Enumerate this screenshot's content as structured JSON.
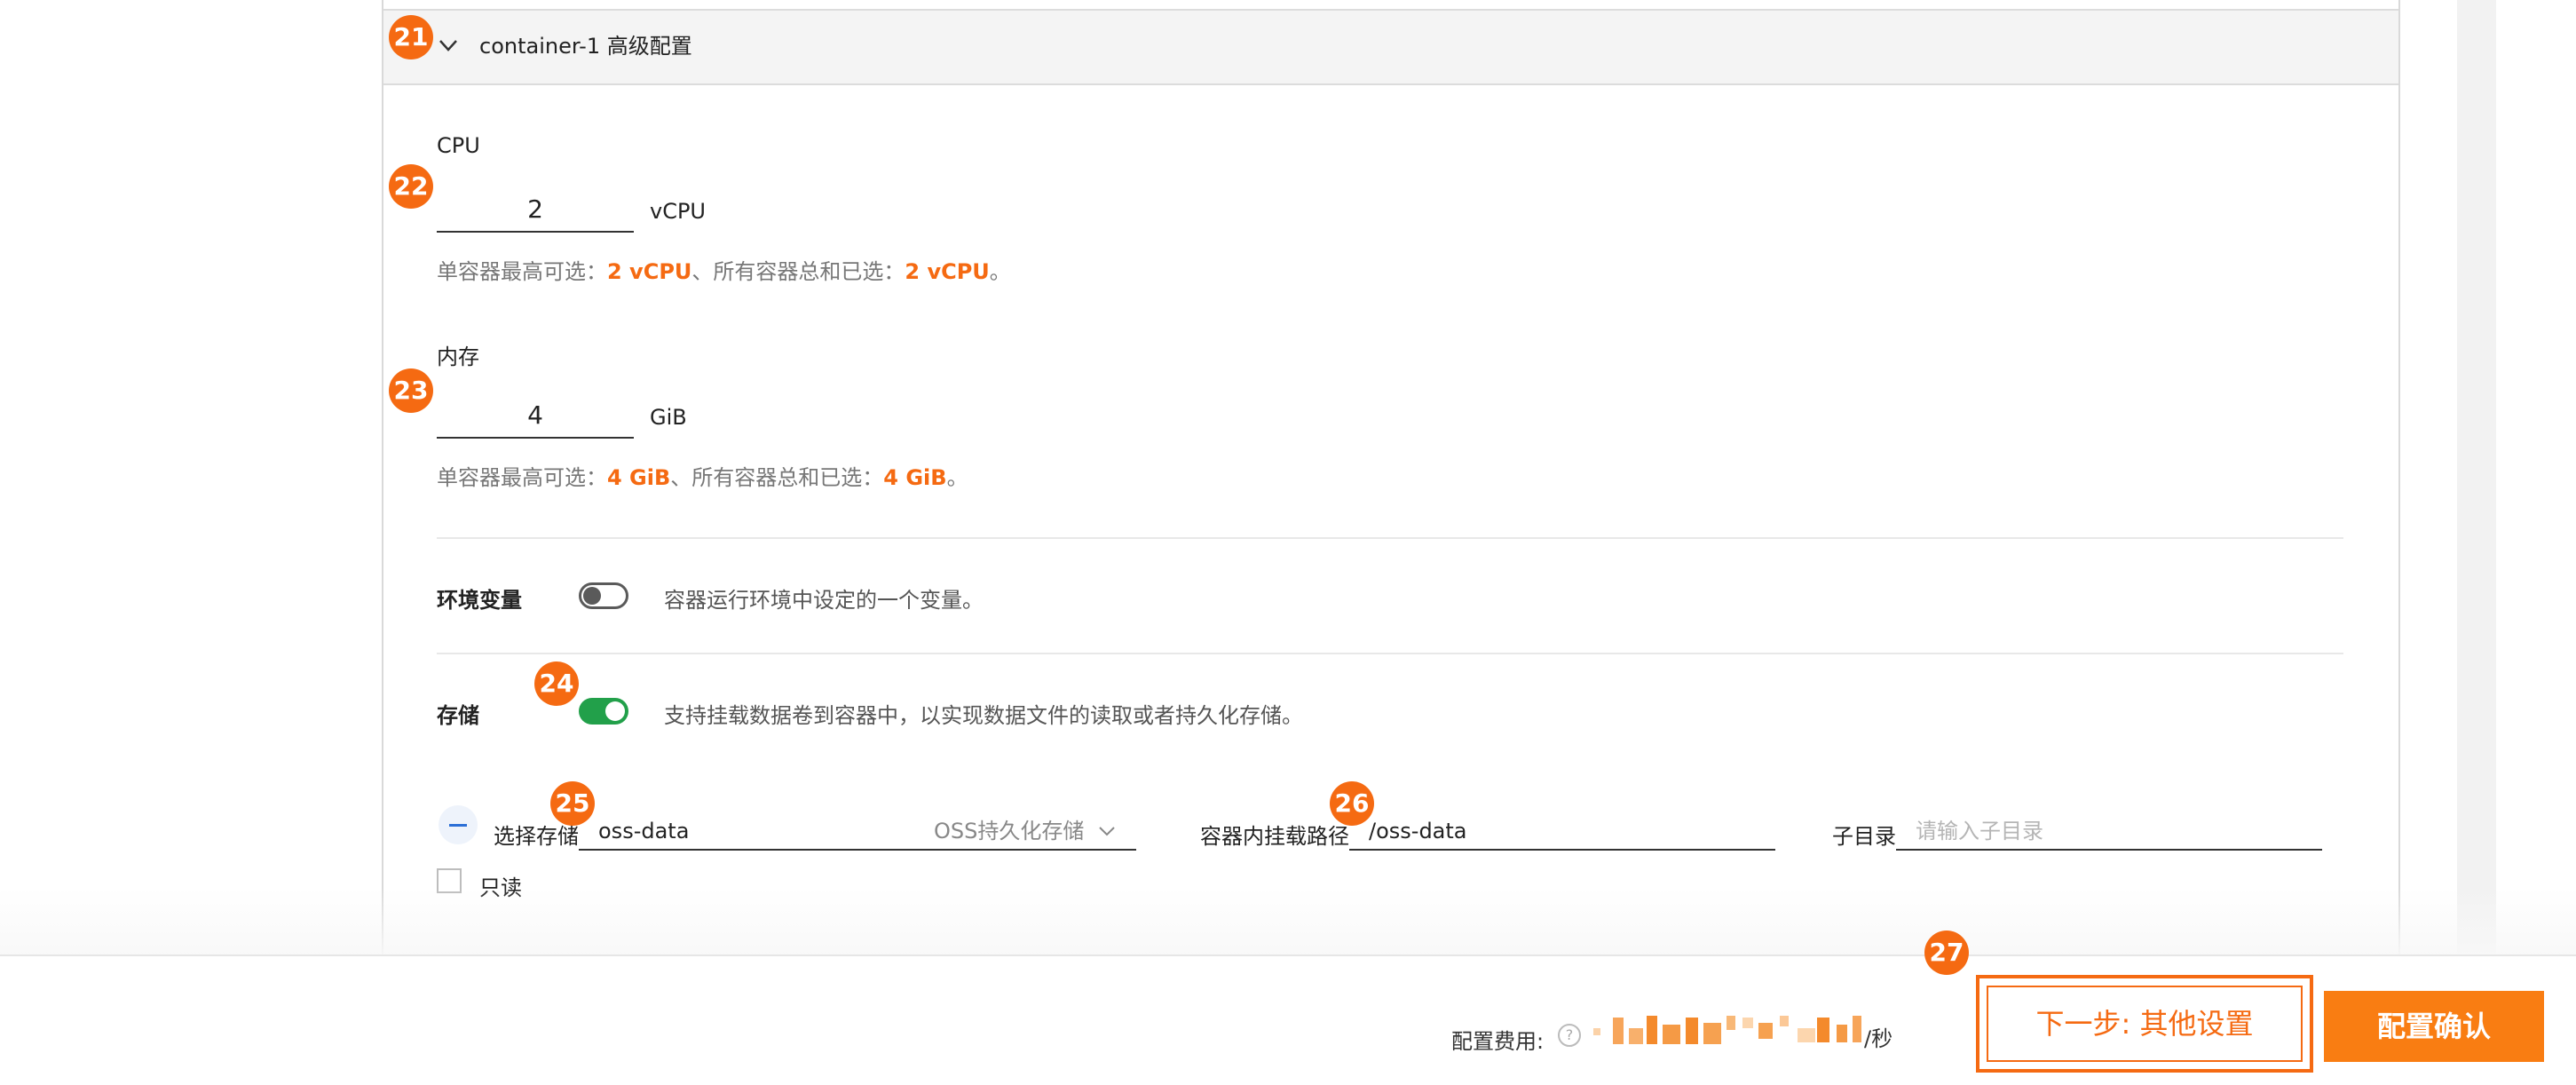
{
  "panel": {
    "title": "container-1 高级配置"
  },
  "badges": {
    "b21": "21",
    "b22": "22",
    "b23": "23",
    "b24": "24",
    "b25": "25",
    "b26": "26",
    "b27": "27"
  },
  "cpu": {
    "label": "CPU",
    "value": "2",
    "unit": "vCPU",
    "hint_prefix": "单容器最高可选：",
    "hint_max": "2 vCPU",
    "hint_mid": "、所有容器总和已选：",
    "hint_total": "2 vCPU",
    "hint_suffix": "。"
  },
  "memory": {
    "label": "内存",
    "value": "4",
    "unit": "GiB",
    "hint_prefix": "单容器最高可选：",
    "hint_max": "4 GiB",
    "hint_mid": "、所有容器总和已选：",
    "hint_total": "4 GiB",
    "hint_suffix": "。"
  },
  "env": {
    "label": "环境变量",
    "enabled": false,
    "description": "容器运行环境中设定的一个变量。"
  },
  "storage": {
    "label": "存储",
    "enabled": true,
    "description": "支持挂载数据卷到容器中，以实现数据文件的读取或者持久化存储。",
    "select_label": "选择存储",
    "select_value": "oss-data",
    "select_type": "OSS持久化存储",
    "mount_label": "容器内挂载路径",
    "mount_value": "/oss-data",
    "subdir_label": "子目录",
    "subdir_placeholder": "请输入子目录",
    "readonly_label": "只读",
    "readonly_checked": false
  },
  "footer": {
    "fee_label": "配置费用:",
    "fee_unit": "/秒",
    "next_button": "下一步: 其他设置",
    "confirm_button": "配置确认"
  },
  "colors": {
    "accent": "#f56a12",
    "toggle_on": "#22a04a",
    "primary_blue": "#2b6fd6"
  }
}
